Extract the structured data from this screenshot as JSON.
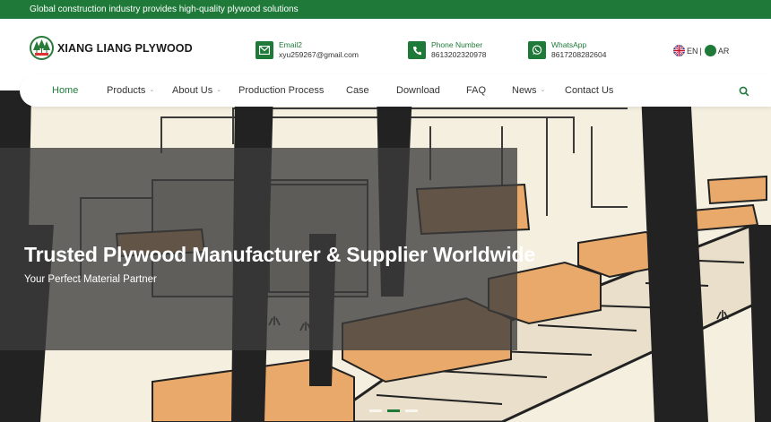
{
  "topbar": {
    "tagline": "Global construction industry provides high-quality plywood solutions"
  },
  "brand": {
    "name": "XIANG LIANG PLYWOOD"
  },
  "contacts": [
    {
      "icon": "mail-icon",
      "label": "Email2",
      "value": "xyu259267@gmail.com"
    },
    {
      "icon": "phone-icon",
      "label": "Phone Number",
      "value": "8613202320978"
    },
    {
      "icon": "whatsapp-icon",
      "label": "WhatsApp",
      "value": "8617208282604"
    }
  ],
  "language": {
    "en": "EN",
    "separator": "|",
    "ar": "AR"
  },
  "nav": {
    "items": [
      {
        "label": "Home",
        "active": true
      },
      {
        "label": "Products",
        "dropdown": true
      },
      {
        "label": "About Us",
        "dropdown": true
      },
      {
        "label": "Production Process"
      },
      {
        "label": "Case"
      },
      {
        "label": "Download"
      },
      {
        "label": "FAQ"
      },
      {
        "label": "News",
        "dropdown": true
      },
      {
        "label": "Contact Us"
      }
    ]
  },
  "hero": {
    "title": "Trusted Plywood Manufacturer & Supplier Worldwide",
    "subtitle": "Your Perfect Material Partner"
  },
  "colors": {
    "brand_green": "#1f7a3a",
    "wood": "#e8a96a",
    "overlay": "#3c3c3c"
  }
}
